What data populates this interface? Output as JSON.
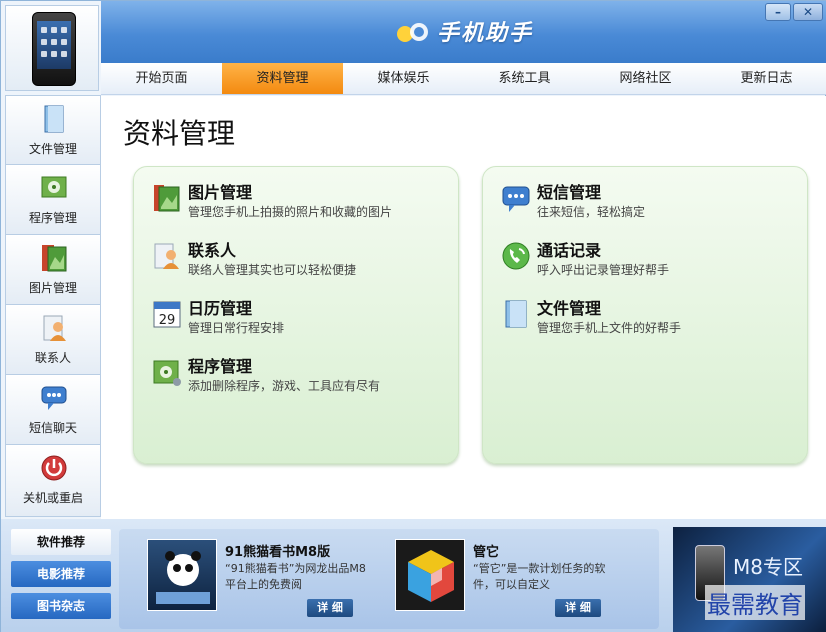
{
  "app": {
    "title": "手机助手"
  },
  "tabs": [
    {
      "label": "开始页面"
    },
    {
      "label": "资料管理",
      "active": true
    },
    {
      "label": "媒体娱乐"
    },
    {
      "label": "系统工具"
    },
    {
      "label": "网络社区"
    },
    {
      "label": "更新日志"
    }
  ],
  "sidebar": {
    "items": [
      {
        "label": "文件管理",
        "icon": "file-icon"
      },
      {
        "label": "程序管理",
        "icon": "program-icon"
      },
      {
        "label": "图片管理",
        "icon": "picture-icon"
      },
      {
        "label": "联系人",
        "icon": "contact-icon"
      },
      {
        "label": "短信聊天",
        "icon": "sms-icon"
      },
      {
        "label": "关机或重启",
        "icon": "power-icon"
      }
    ]
  },
  "main": {
    "title": "资料管理",
    "left": [
      {
        "title": "图片管理",
        "desc": "管理您手机上拍摄的照片和收藏的图片"
      },
      {
        "title": "联系人",
        "desc": "联络人管理其实也可以轻松便捷"
      },
      {
        "title": "日历管理",
        "desc": "管理日常行程安排",
        "day": "29"
      },
      {
        "title": "程序管理",
        "desc": "添加删除程序，游戏、工具应有尽有"
      }
    ],
    "right": [
      {
        "title": "短信管理",
        "desc": "往来短信，轻松搞定"
      },
      {
        "title": "通话记录",
        "desc": "呼入呼出记录管理好帮手"
      },
      {
        "title": "文件管理",
        "desc": "管理您手机上文件的好帮手"
      }
    ]
  },
  "bottom": {
    "tabs": [
      "软件推荐",
      "电影推荐",
      "图书杂志"
    ],
    "recs": [
      {
        "title": "91熊猫看书M8版",
        "desc": "“91熊猫看书”为网龙出品M8平台上的免费阅",
        "detail": "详 细"
      },
      {
        "title": "管它",
        "desc": "“管它”是一款计划任务的软件，可以自定义",
        "detail": "详 细"
      }
    ],
    "promo": "M8专区"
  },
  "watermark": "最需教育"
}
